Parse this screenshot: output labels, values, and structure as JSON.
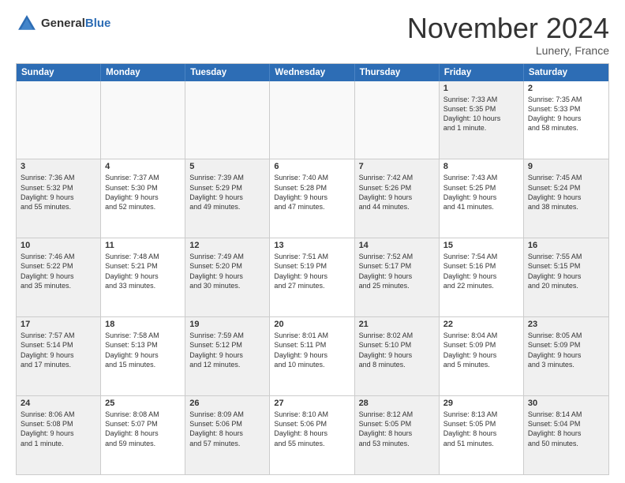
{
  "header": {
    "logo_general": "General",
    "logo_blue": "Blue",
    "month_year": "November 2024",
    "location": "Lunery, France"
  },
  "days_of_week": [
    "Sunday",
    "Monday",
    "Tuesday",
    "Wednesday",
    "Thursday",
    "Friday",
    "Saturday"
  ],
  "weeks": [
    [
      {
        "day": "",
        "info": "",
        "shaded": false,
        "empty": true
      },
      {
        "day": "",
        "info": "",
        "shaded": false,
        "empty": true
      },
      {
        "day": "",
        "info": "",
        "shaded": false,
        "empty": true
      },
      {
        "day": "",
        "info": "",
        "shaded": false,
        "empty": true
      },
      {
        "day": "",
        "info": "",
        "shaded": false,
        "empty": true
      },
      {
        "day": "1",
        "info": "Sunrise: 7:33 AM\nSunset: 5:35 PM\nDaylight: 10 hours\nand 1 minute.",
        "shaded": true,
        "empty": false
      },
      {
        "day": "2",
        "info": "Sunrise: 7:35 AM\nSunset: 5:33 PM\nDaylight: 9 hours\nand 58 minutes.",
        "shaded": false,
        "empty": false
      }
    ],
    [
      {
        "day": "3",
        "info": "Sunrise: 7:36 AM\nSunset: 5:32 PM\nDaylight: 9 hours\nand 55 minutes.",
        "shaded": true,
        "empty": false
      },
      {
        "day": "4",
        "info": "Sunrise: 7:37 AM\nSunset: 5:30 PM\nDaylight: 9 hours\nand 52 minutes.",
        "shaded": false,
        "empty": false
      },
      {
        "day": "5",
        "info": "Sunrise: 7:39 AM\nSunset: 5:29 PM\nDaylight: 9 hours\nand 49 minutes.",
        "shaded": true,
        "empty": false
      },
      {
        "day": "6",
        "info": "Sunrise: 7:40 AM\nSunset: 5:28 PM\nDaylight: 9 hours\nand 47 minutes.",
        "shaded": false,
        "empty": false
      },
      {
        "day": "7",
        "info": "Sunrise: 7:42 AM\nSunset: 5:26 PM\nDaylight: 9 hours\nand 44 minutes.",
        "shaded": true,
        "empty": false
      },
      {
        "day": "8",
        "info": "Sunrise: 7:43 AM\nSunset: 5:25 PM\nDaylight: 9 hours\nand 41 minutes.",
        "shaded": false,
        "empty": false
      },
      {
        "day": "9",
        "info": "Sunrise: 7:45 AM\nSunset: 5:24 PM\nDaylight: 9 hours\nand 38 minutes.",
        "shaded": true,
        "empty": false
      }
    ],
    [
      {
        "day": "10",
        "info": "Sunrise: 7:46 AM\nSunset: 5:22 PM\nDaylight: 9 hours\nand 35 minutes.",
        "shaded": true,
        "empty": false
      },
      {
        "day": "11",
        "info": "Sunrise: 7:48 AM\nSunset: 5:21 PM\nDaylight: 9 hours\nand 33 minutes.",
        "shaded": false,
        "empty": false
      },
      {
        "day": "12",
        "info": "Sunrise: 7:49 AM\nSunset: 5:20 PM\nDaylight: 9 hours\nand 30 minutes.",
        "shaded": true,
        "empty": false
      },
      {
        "day": "13",
        "info": "Sunrise: 7:51 AM\nSunset: 5:19 PM\nDaylight: 9 hours\nand 27 minutes.",
        "shaded": false,
        "empty": false
      },
      {
        "day": "14",
        "info": "Sunrise: 7:52 AM\nSunset: 5:17 PM\nDaylight: 9 hours\nand 25 minutes.",
        "shaded": true,
        "empty": false
      },
      {
        "day": "15",
        "info": "Sunrise: 7:54 AM\nSunset: 5:16 PM\nDaylight: 9 hours\nand 22 minutes.",
        "shaded": false,
        "empty": false
      },
      {
        "day": "16",
        "info": "Sunrise: 7:55 AM\nSunset: 5:15 PM\nDaylight: 9 hours\nand 20 minutes.",
        "shaded": true,
        "empty": false
      }
    ],
    [
      {
        "day": "17",
        "info": "Sunrise: 7:57 AM\nSunset: 5:14 PM\nDaylight: 9 hours\nand 17 minutes.",
        "shaded": true,
        "empty": false
      },
      {
        "day": "18",
        "info": "Sunrise: 7:58 AM\nSunset: 5:13 PM\nDaylight: 9 hours\nand 15 minutes.",
        "shaded": false,
        "empty": false
      },
      {
        "day": "19",
        "info": "Sunrise: 7:59 AM\nSunset: 5:12 PM\nDaylight: 9 hours\nand 12 minutes.",
        "shaded": true,
        "empty": false
      },
      {
        "day": "20",
        "info": "Sunrise: 8:01 AM\nSunset: 5:11 PM\nDaylight: 9 hours\nand 10 minutes.",
        "shaded": false,
        "empty": false
      },
      {
        "day": "21",
        "info": "Sunrise: 8:02 AM\nSunset: 5:10 PM\nDaylight: 9 hours\nand 8 minutes.",
        "shaded": true,
        "empty": false
      },
      {
        "day": "22",
        "info": "Sunrise: 8:04 AM\nSunset: 5:09 PM\nDaylight: 9 hours\nand 5 minutes.",
        "shaded": false,
        "empty": false
      },
      {
        "day": "23",
        "info": "Sunrise: 8:05 AM\nSunset: 5:09 PM\nDaylight: 9 hours\nand 3 minutes.",
        "shaded": true,
        "empty": false
      }
    ],
    [
      {
        "day": "24",
        "info": "Sunrise: 8:06 AM\nSunset: 5:08 PM\nDaylight: 9 hours\nand 1 minute.",
        "shaded": true,
        "empty": false
      },
      {
        "day": "25",
        "info": "Sunrise: 8:08 AM\nSunset: 5:07 PM\nDaylight: 8 hours\nand 59 minutes.",
        "shaded": false,
        "empty": false
      },
      {
        "day": "26",
        "info": "Sunrise: 8:09 AM\nSunset: 5:06 PM\nDaylight: 8 hours\nand 57 minutes.",
        "shaded": true,
        "empty": false
      },
      {
        "day": "27",
        "info": "Sunrise: 8:10 AM\nSunset: 5:06 PM\nDaylight: 8 hours\nand 55 minutes.",
        "shaded": false,
        "empty": false
      },
      {
        "day": "28",
        "info": "Sunrise: 8:12 AM\nSunset: 5:05 PM\nDaylight: 8 hours\nand 53 minutes.",
        "shaded": true,
        "empty": false
      },
      {
        "day": "29",
        "info": "Sunrise: 8:13 AM\nSunset: 5:05 PM\nDaylight: 8 hours\nand 51 minutes.",
        "shaded": false,
        "empty": false
      },
      {
        "day": "30",
        "info": "Sunrise: 8:14 AM\nSunset: 5:04 PM\nDaylight: 8 hours\nand 50 minutes.",
        "shaded": true,
        "empty": false
      }
    ]
  ]
}
